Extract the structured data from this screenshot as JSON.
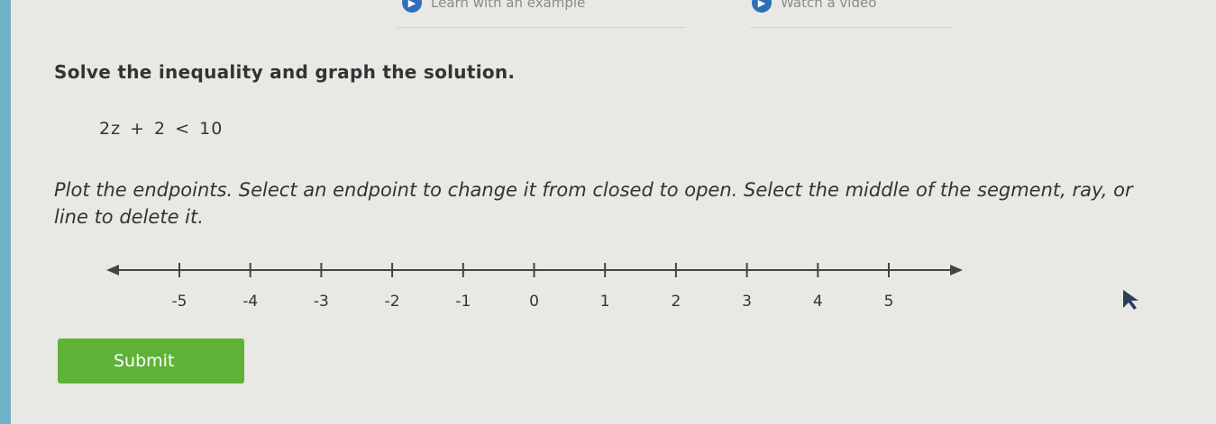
{
  "top_links": [
    {
      "label": "Learn with an example",
      "icon": "video-icon"
    },
    {
      "label": "Watch a video",
      "icon": "play-icon"
    }
  ],
  "question": {
    "title": "Solve the inequality and graph the solution.",
    "inequality": "2z + 2 < 10",
    "instructions": "Plot the endpoints. Select an endpoint to change it from closed to open. Select the middle of the segment, ray, or line to delete it."
  },
  "number_line": {
    "ticks": [
      "-5",
      "-4",
      "-3",
      "-2",
      "-1",
      "0",
      "1",
      "2",
      "3",
      "4",
      "5"
    ]
  },
  "submit_label": "Submit",
  "colors": {
    "submit": "#5fb238",
    "icon_blue": "#2f6fb5",
    "background": "#e9e8e4"
  }
}
